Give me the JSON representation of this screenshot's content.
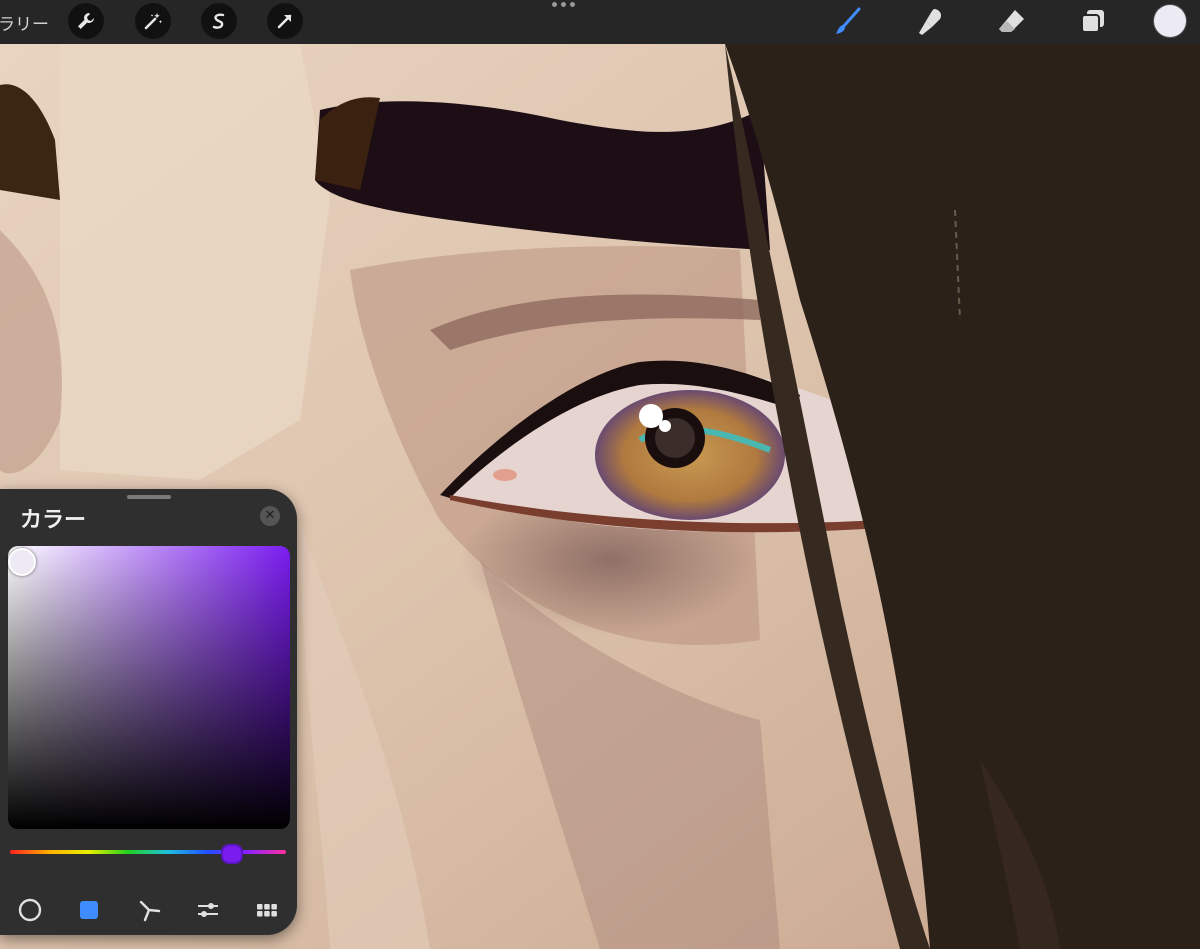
{
  "toolbar": {
    "gallery_label": "ラリー",
    "left_tools": [
      {
        "name": "wrench-icon"
      },
      {
        "name": "magic-wand-icon"
      },
      {
        "name": "selection-s-icon"
      },
      {
        "name": "arrow-transform-icon"
      }
    ],
    "right_tools": [
      {
        "name": "brush-icon",
        "active_color": "#3f8cff"
      },
      {
        "name": "smudge-icon"
      },
      {
        "name": "eraser-icon"
      },
      {
        "name": "layers-icon"
      }
    ],
    "current_color": "#eceaf3"
  },
  "color_panel": {
    "title": "カラー",
    "hue_color": "#7a1cf0",
    "modes": [
      {
        "name": "disc-mode-icon"
      },
      {
        "name": "classic-mode-icon",
        "active": true,
        "active_color": "#3f8cff"
      },
      {
        "name": "harmony-mode-icon"
      },
      {
        "name": "value-mode-icon"
      },
      {
        "name": "palettes-mode-icon"
      }
    ]
  },
  "canvas": {
    "subject": "painting-eye-closeup"
  }
}
